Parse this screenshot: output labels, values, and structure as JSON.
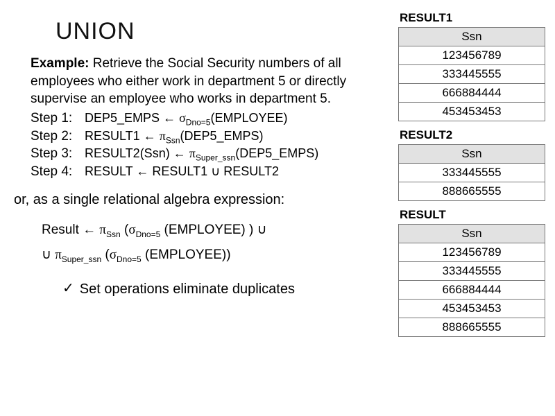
{
  "title": "UNION",
  "example": {
    "label": "Example:",
    "text": "Retrieve the Social Security numbers of all employees who either work in department 5 or directly supervise an employee who works in department 5."
  },
  "steps": [
    {
      "label": "Step 1:",
      "lhs": "DEP5_EMPS",
      "assign": "←",
      "op": "σ",
      "sub": "Dno=5",
      "arg": "(EMPLOYEE)"
    },
    {
      "label": "Step 2:",
      "lhs": "RESULT1",
      "assign": "←",
      "op": "π",
      "sub": "Ssn",
      "arg": "(DEP5_EMPS)"
    },
    {
      "label": "Step 3:",
      "lhs": "RESULT2(Ssn)",
      "assign": "←",
      "op": "π",
      "sub": "Super_ssn",
      "arg": "(DEP5_EMPS)"
    },
    {
      "label": "Step 4:",
      "lhs": "RESULT",
      "assign": "←",
      "plain": "RESULT1 ∪ RESULT2"
    }
  ],
  "or_line": "or, as a single relational algebra expression:",
  "single_expr": {
    "line1_a": "Result ← ",
    "line1_op1": "π",
    "line1_sub1": "Ssn",
    "line1_b": " (",
    "line1_op2": "σ",
    "line1_sub2": "Dno=5",
    "line1_c": " (EMPLOYEE) ) ∪",
    "line2_a": "∪  ",
    "line2_op1": "π",
    "line2_sub1": "Super_ssn",
    "line2_b": " (",
    "line2_op2": "σ",
    "line2_sub2": "Dno=5",
    "line2_c": " (EMPLOYEE))"
  },
  "note": {
    "check": "✓",
    "text": "Set operations eliminate duplicates"
  },
  "tables": {
    "result1": {
      "caption": "RESULT1",
      "header": "Ssn",
      "rows": [
        "123456789",
        "333445555",
        "666884444",
        "453453453"
      ]
    },
    "result2": {
      "caption": "RESULT2",
      "header": "Ssn",
      "rows": [
        "333445555",
        "888665555"
      ]
    },
    "result": {
      "caption": "RESULT",
      "header": "Ssn",
      "rows": [
        "123456789",
        "333445555",
        "666884444",
        "453453453",
        "888665555"
      ]
    }
  }
}
